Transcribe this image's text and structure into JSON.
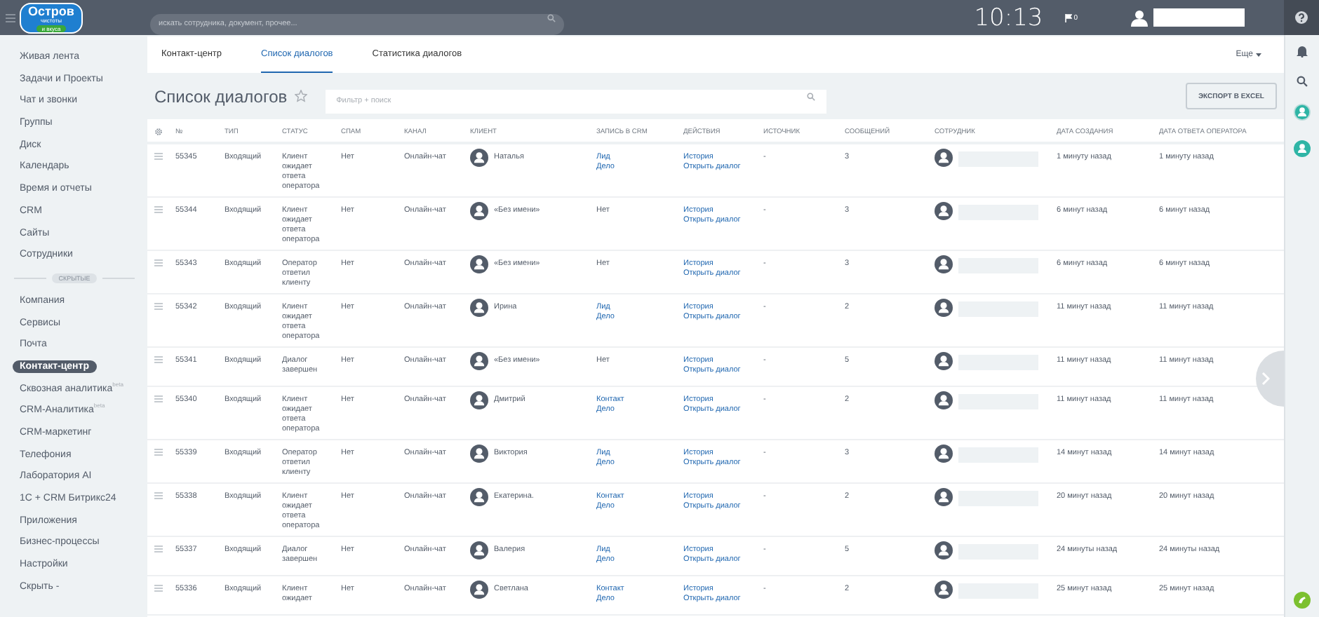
{
  "topbar": {
    "logo": {
      "title": "Остров",
      "subtitle": "чистоты",
      "tagline": "и вкуса"
    },
    "search_placeholder": "искать сотрудника, документ, прочее...",
    "clock": "10:13",
    "notification_count": "0"
  },
  "sidebar": {
    "items": [
      {
        "kind": "link",
        "label": "Живая лента",
        "selected": false
      },
      {
        "kind": "link",
        "label": "Задачи и Проекты",
        "selected": false
      },
      {
        "kind": "link",
        "label": "Чат и звонки",
        "selected": false
      },
      {
        "kind": "link",
        "label": "Группы",
        "selected": false
      },
      {
        "kind": "link",
        "label": "Диск",
        "selected": false
      },
      {
        "kind": "link",
        "label": "Календарь",
        "selected": false
      },
      {
        "kind": "link",
        "label": "Время и отчеты",
        "selected": false
      },
      {
        "kind": "link",
        "label": "CRM",
        "selected": false
      },
      {
        "kind": "link",
        "label": "Сайты",
        "selected": false
      },
      {
        "kind": "link",
        "label": "Сотрудники",
        "selected": false
      },
      {
        "kind": "divider",
        "label": "СКРЫТЫЕ"
      },
      {
        "kind": "link",
        "label": "Компания",
        "selected": false
      },
      {
        "kind": "link",
        "label": "Сервисы",
        "selected": false
      },
      {
        "kind": "link",
        "label": "Почта",
        "selected": false
      },
      {
        "kind": "link",
        "label": "Контакт-центр",
        "selected": true
      },
      {
        "kind": "link",
        "label": "Сквозная аналитика",
        "badge": "beta",
        "selected": false
      },
      {
        "kind": "link",
        "label": "CRM-Аналитика",
        "badge": "beta",
        "selected": false
      },
      {
        "kind": "link",
        "label": "CRM-маркетинг",
        "selected": false
      },
      {
        "kind": "link",
        "label": "Телефония",
        "selected": false
      },
      {
        "kind": "link",
        "label": "Лаборатория AI",
        "selected": false
      },
      {
        "kind": "link",
        "label": "1С + CRM Битрикс24",
        "selected": false
      },
      {
        "kind": "link",
        "label": "Приложения",
        "selected": false
      },
      {
        "kind": "link",
        "label": "Бизнес-процессы",
        "selected": false
      },
      {
        "kind": "link",
        "label": "Настройки",
        "selected": false
      },
      {
        "kind": "link",
        "label": "Скрыть -",
        "selected": false
      }
    ]
  },
  "tabs": [
    {
      "label": "Контакт-центр",
      "selected": false
    },
    {
      "label": "Список диалогов",
      "selected": true
    },
    {
      "label": "Статистика диалогов",
      "selected": false
    }
  ],
  "more_menu": "Еще",
  "page": {
    "title": "Список диалогов",
    "filter_placeholder": "Фильтр + поиск",
    "export_button": "ЭКСПОРТ В EXCEL"
  },
  "table": {
    "columns": [
      "№",
      "ТИП",
      "СТАТУС",
      "СПАМ",
      "КАНАЛ",
      "КЛИЕНТ",
      "ЗАПИСЬ В CRM",
      "ДЕЙСТВИЯ",
      "ИСТОЧНИК",
      "СООБЩЕНИЙ",
      "СОТРУДНИК",
      "ДАТА СОЗДАНИЯ",
      "ДАТА ОТВЕТА ОПЕРАТОРА"
    ],
    "rows": [
      {
        "number": "55345",
        "type": "Входящий",
        "status": "Клиент ожидает ответа оператора",
        "spam": "Нет",
        "channel": "Онлайн-чат",
        "client": "Наталья",
        "crm": {
          "kind": "links",
          "items": [
            "Лид",
            "Дело"
          ]
        },
        "actions": [
          "История",
          "Открыть диалог"
        ],
        "source": "-",
        "messages": "3",
        "created": "1 минуту назад",
        "answered": "1 минуту назад"
      },
      {
        "number": "55344",
        "type": "Входящий",
        "status": "Клиент ожидает ответа оператора",
        "spam": "Нет",
        "channel": "Онлайн-чат",
        "client": "«Без имени»",
        "crm": {
          "kind": "text",
          "text": "Нет"
        },
        "actions": [
          "История",
          "Открыть диалог"
        ],
        "source": "-",
        "messages": "3",
        "created": "6 минут назад",
        "answered": "6 минут назад"
      },
      {
        "number": "55343",
        "type": "Входящий",
        "status": "Оператор ответил клиенту",
        "spam": "Нет",
        "channel": "Онлайн-чат",
        "client": "«Без имени»",
        "crm": {
          "kind": "text",
          "text": "Нет"
        },
        "actions": [
          "История",
          "Открыть диалог"
        ],
        "source": "-",
        "messages": "3",
        "created": "6 минут назад",
        "answered": "6 минут назад"
      },
      {
        "number": "55342",
        "type": "Входящий",
        "status": "Клиент ожидает ответа оператора",
        "spam": "Нет",
        "channel": "Онлайн-чат",
        "client": "Ирина",
        "crm": {
          "kind": "links",
          "items": [
            "Лид",
            "Дело"
          ]
        },
        "actions": [
          "История",
          "Открыть диалог"
        ],
        "source": "-",
        "messages": "2",
        "created": "11 минут назад",
        "answered": "11 минут назад"
      },
      {
        "number": "55341",
        "type": "Входящий",
        "status": "Диалог завершен",
        "spam": "Нет",
        "channel": "Онлайн-чат",
        "client": "«Без имени»",
        "crm": {
          "kind": "text",
          "text": "Нет"
        },
        "actions": [
          "История",
          "Открыть диалог"
        ],
        "source": "-",
        "messages": "5",
        "created": "11 минут назад",
        "answered": "11 минут назад"
      },
      {
        "number": "55340",
        "type": "Входящий",
        "status": "Клиент ожидает ответа оператора",
        "spam": "Нет",
        "channel": "Онлайн-чат",
        "client": "Дмитрий",
        "crm": {
          "kind": "links",
          "items": [
            "Контакт",
            "Дело"
          ]
        },
        "actions": [
          "История",
          "Открыть диалог"
        ],
        "source": "-",
        "messages": "2",
        "created": "11 минут назад",
        "answered": "11 минут назад"
      },
      {
        "number": "55339",
        "type": "Входящий",
        "status": "Оператор ответил клиенту",
        "spam": "Нет",
        "channel": "Онлайн-чат",
        "client": "Виктория",
        "crm": {
          "kind": "links",
          "items": [
            "Лид",
            "Дело"
          ]
        },
        "actions": [
          "История",
          "Открыть диалог"
        ],
        "source": "-",
        "messages": "3",
        "created": "14 минут назад",
        "answered": "14 минут назад"
      },
      {
        "number": "55338",
        "type": "Входящий",
        "status": "Клиент ожидает ответа оператора",
        "spam": "Нет",
        "channel": "Онлайн-чат",
        "client": "Екатерина.",
        "crm": {
          "kind": "links",
          "items": [
            "Контакт",
            "Дело"
          ]
        },
        "actions": [
          "История",
          "Открыть диалог"
        ],
        "source": "-",
        "messages": "2",
        "created": "20 минут назад",
        "answered": "20 минут назад"
      },
      {
        "number": "55337",
        "type": "Входящий",
        "status": "Диалог завершен",
        "spam": "Нет",
        "channel": "Онлайн-чат",
        "client": "Валерия",
        "crm": {
          "kind": "links",
          "items": [
            "Лид",
            "Дело"
          ]
        },
        "actions": [
          "История",
          "Открыть диалог"
        ],
        "source": "-",
        "messages": "5",
        "created": "24 минуты назад",
        "answered": "24 минуты назад"
      },
      {
        "number": "55336",
        "type": "Входящий",
        "status": "Клиент ожидает",
        "spam": "Нет",
        "channel": "Онлайн-чат",
        "client": "Светлана",
        "crm": {
          "kind": "links",
          "items": [
            "Контакт",
            "Дело"
          ]
        },
        "actions": [
          "История",
          "Открыть диалог"
        ],
        "source": "-",
        "messages": "2",
        "created": "25 минут назад",
        "answered": "25 минут назад"
      }
    ]
  }
}
